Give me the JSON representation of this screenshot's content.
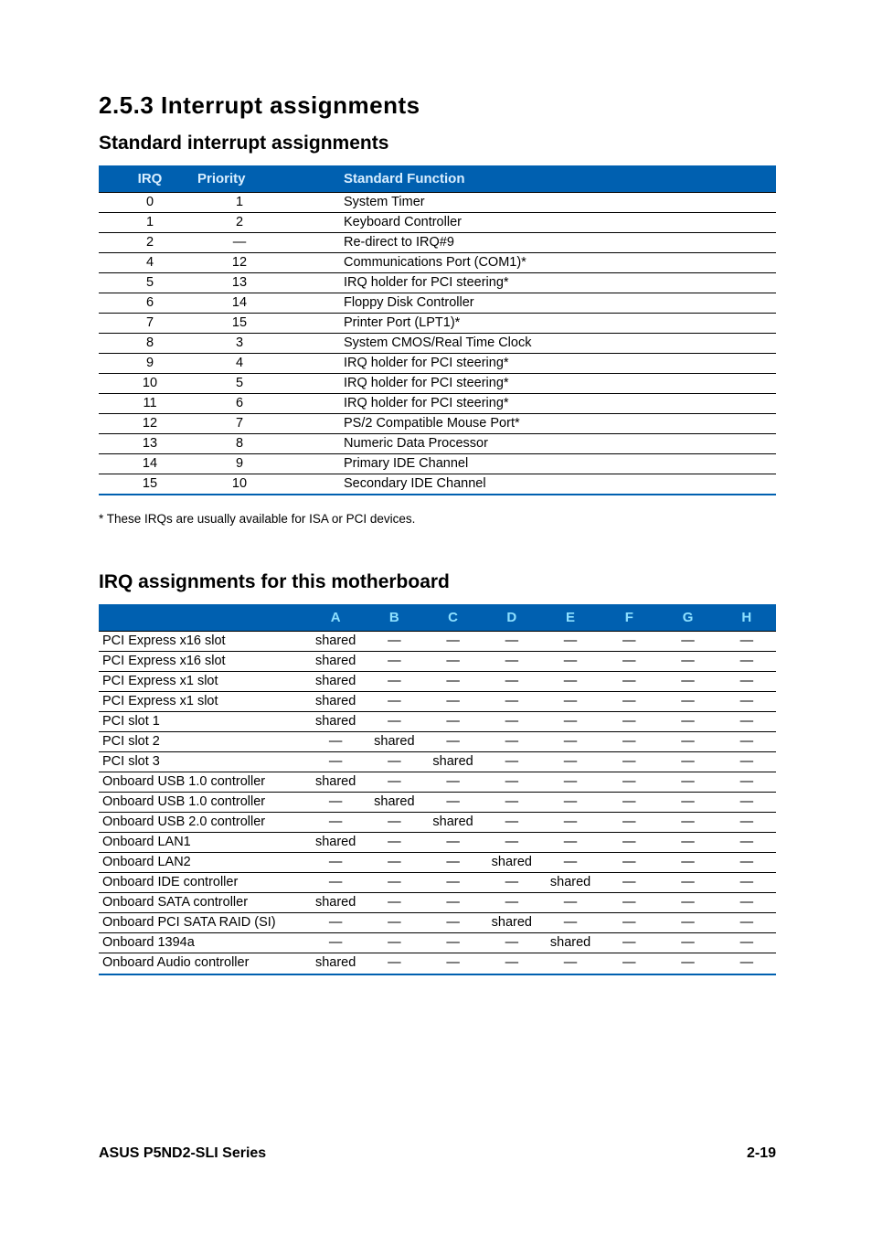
{
  "headings": {
    "main": "2.5.3   Interrupt assignments",
    "sub1": "Standard interrupt assignments",
    "sub2": "IRQ assignments for this motherboard"
  },
  "table1": {
    "headers": {
      "irq": "IRQ",
      "priority": "Priority",
      "func": "Standard Function"
    },
    "rows": [
      {
        "irq": "0",
        "priority": "1",
        "func": "System Timer"
      },
      {
        "irq": "1",
        "priority": "2",
        "func": "Keyboard Controller"
      },
      {
        "irq": "2",
        "priority": "—",
        "func": "Re-direct to IRQ#9"
      },
      {
        "irq": "4",
        "priority": "12",
        "func": "Communications Port (COM1)*"
      },
      {
        "irq": "5",
        "priority": "13",
        "func": "IRQ holder for PCI steering*"
      },
      {
        "irq": "6",
        "priority": "14",
        "func": "Floppy Disk Controller"
      },
      {
        "irq": "7",
        "priority": "15",
        "func": "Printer Port (LPT1)*"
      },
      {
        "irq": "8",
        "priority": "3",
        "func": "System CMOS/Real Time Clock"
      },
      {
        "irq": "9",
        "priority": "4",
        "func": "IRQ holder for PCI steering*"
      },
      {
        "irq": "10",
        "priority": "5",
        "func": "IRQ holder for PCI steering*"
      },
      {
        "irq": "11",
        "priority": "6",
        "func": "IRQ holder for PCI steering*"
      },
      {
        "irq": "12",
        "priority": "7",
        "func": "PS/2 Compatible Mouse Port*"
      },
      {
        "irq": "13",
        "priority": "8",
        "func": "Numeric Data Processor"
      },
      {
        "irq": "14",
        "priority": "9",
        "func": "Primary IDE Channel"
      },
      {
        "irq": "15",
        "priority": "10",
        "func": "Secondary IDE Channel"
      }
    ]
  },
  "footnote": "* These IRQs are usually available for ISA or PCI devices.",
  "table2": {
    "cols": [
      "A",
      "B",
      "C",
      "D",
      "E",
      "F",
      "G",
      "H"
    ],
    "rows": [
      {
        "name": "PCI Express x16 slot",
        "v": [
          "shared",
          "—",
          "—",
          "—",
          "—",
          "—",
          "—",
          "—"
        ]
      },
      {
        "name": "PCI Express x16 slot",
        "v": [
          "shared",
          "—",
          "—",
          "—",
          "—",
          "—",
          "—",
          "—"
        ]
      },
      {
        "name": "PCI Express x1 slot",
        "v": [
          "shared",
          "—",
          "—",
          "—",
          "—",
          "—",
          "—",
          "—"
        ]
      },
      {
        "name": "PCI Express x1 slot",
        "v": [
          "shared",
          "—",
          "—",
          "—",
          "—",
          "—",
          "—",
          "—"
        ]
      },
      {
        "name": "PCI slot 1",
        "v": [
          "shared",
          "—",
          "—",
          "—",
          "—",
          "—",
          "—",
          "—"
        ]
      },
      {
        "name": "PCI slot 2",
        "v": [
          "—",
          "shared",
          "—",
          "—",
          "—",
          "—",
          "—",
          "—"
        ]
      },
      {
        "name": "PCI slot 3",
        "v": [
          "—",
          "—",
          "shared",
          "—",
          "—",
          "—",
          "—",
          "—"
        ]
      },
      {
        "name": "Onboard USB 1.0 controller",
        "v": [
          "shared",
          "—",
          "—",
          "—",
          "—",
          "—",
          "—",
          "—"
        ]
      },
      {
        "name": "Onboard USB 1.0 controller",
        "v": [
          "—",
          "shared",
          "—",
          "—",
          "—",
          "—",
          "—",
          "—"
        ]
      },
      {
        "name": "Onboard USB 2.0 controller",
        "v": [
          "—",
          "—",
          "shared",
          "—",
          "—",
          "—",
          "—",
          "—"
        ]
      },
      {
        "name": "Onboard LAN1",
        "v": [
          "shared",
          "—",
          "—",
          "—",
          "—",
          "—",
          "—",
          "—"
        ]
      },
      {
        "name": "Onboard LAN2",
        "v": [
          "—",
          "—",
          "—",
          "shared",
          "—",
          "—",
          "—",
          "—"
        ]
      },
      {
        "name": "Onboard IDE controller",
        "v": [
          "—",
          "—",
          "—",
          "—",
          "shared",
          "—",
          "—",
          "—"
        ]
      },
      {
        "name": "Onboard SATA controller",
        "v": [
          "shared",
          "—",
          "—",
          "—",
          "—",
          "—",
          "—",
          "—"
        ]
      },
      {
        "name": "Onboard PCI SATA RAID (SI)",
        "v": [
          "—",
          "—",
          "—",
          "shared",
          "—",
          "—",
          "—",
          "—"
        ]
      },
      {
        "name": "Onboard 1394a",
        "v": [
          "—",
          "—",
          "—",
          "—",
          "shared",
          "—",
          "—",
          "—"
        ]
      },
      {
        "name": "Onboard Audio controller",
        "v": [
          "shared",
          "—",
          "—",
          "—",
          "—",
          "—",
          "—",
          "—"
        ]
      }
    ]
  },
  "footer": {
    "left": "ASUS P5ND2-SLI Series",
    "right": "2-19"
  }
}
